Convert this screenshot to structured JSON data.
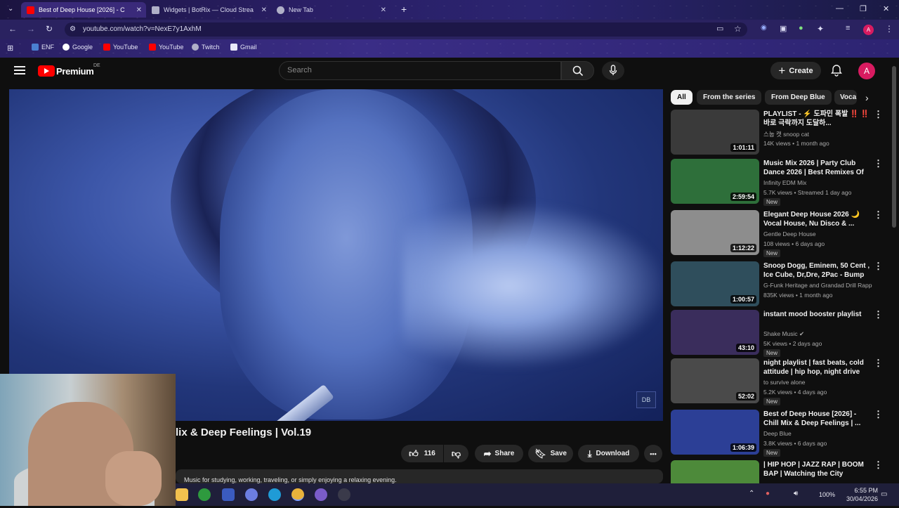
{
  "browser": {
    "tabs": [
      {
        "title": "Best of Deep House [2026] - C",
        "active": true,
        "favicon_color": "#ff0000"
      },
      {
        "title": "Widgets | BotRix — Cloud Strea",
        "active": false,
        "favicon_color": "#b0b0c8"
      },
      {
        "title": "New Tab",
        "active": false,
        "favicon_color": "#b0b0c8"
      }
    ],
    "new_tab_label": "+",
    "url": "youtube.com/watch?v=NexE7y1AxhM",
    "profile_initial": "A",
    "bookmarks": [
      "ENF",
      "Google",
      "YouTube",
      "YouTube",
      "Twitch",
      "Gmail"
    ]
  },
  "youtube": {
    "logo_text": "Premium",
    "country": "DE",
    "search_placeholder": "Search",
    "create_label": "Create",
    "avatar_initial": "A"
  },
  "video": {
    "title": "lix & Deep Feelings | Vol.19",
    "likes": "116",
    "share_label": "Share",
    "save_label": "Save",
    "download_label": "Download",
    "more_label": "•••",
    "description": "Music for studying, working, traveling, or simply enjoying a relaxing evening."
  },
  "sidebar": {
    "chips": [
      "All",
      "From the series",
      "From Deep Blue",
      "Voca"
    ],
    "items": [
      {
        "title": "PLAYLIST - ⚡ 도파민 폭발 ‼️ ‼️ 바로 극락까지 도달하...",
        "channel": "스눕 캣 snoop cat",
        "meta": "14K views • 1 month ago",
        "duration": "1:01:11",
        "badge": "",
        "thumb": "#3a3a3a"
      },
      {
        "title": "Music Mix 2026 | Party Club Dance 2026 | Best Remixes Of ...",
        "channel": "Infinity EDM Mix",
        "meta": "5.7K views • Streamed 1 day ago",
        "duration": "2:59:54",
        "badge": "New",
        "thumb": "#2e6f3a"
      },
      {
        "title": "Elegant Deep House 2026 🌙 Vocal House, Nu Disco & ...",
        "channel": "Gentle Deep House",
        "meta": "108 views • 6 days ago",
        "duration": "1:12:22",
        "badge": "New",
        "thumb": "#8d8d8d"
      },
      {
        "title": "Snoop Dogg, Eminem, 50 Cent , Ice Cube, Dr,Dre, 2Pac - Bump ...",
        "channel": "G-Funk Heritage and Grandad Drill Rappe...",
        "meta": "835K views • 1 month ago",
        "duration": "1:00:57",
        "badge": "",
        "thumb": "#2f4e5c"
      },
      {
        "title": "instant mood booster playlist",
        "channel": "Shake Music ✔",
        "meta": "5K views • 2 days ago",
        "duration": "43:10",
        "badge": "New",
        "thumb": "#3a2d5c"
      },
      {
        "title": "night playlist | fast beats, cold attitude | hip hop, night drive",
        "channel": "to survive alone",
        "meta": "5.2K views • 4 days ago",
        "duration": "52:02",
        "badge": "New",
        "thumb": "#4a4a4a"
      },
      {
        "title": "Best of Deep House [2026] - Chill Mix & Deep Feelings | ...",
        "channel": "Deep Blue",
        "meta": "3.8K views • 6 days ago",
        "duration": "1:06:39",
        "badge": "New",
        "thumb": "#2c3f96"
      },
      {
        "title": "| HIP HOP | JAZZ RAP | BOOM BAP | Watching the City Breath...",
        "channel": "",
        "meta": "",
        "duration": "",
        "badge": "",
        "thumb": "#4d8a3a"
      }
    ]
  },
  "taskbar": {
    "battery": "100%",
    "time": "6:55 PM",
    "date": "30/04/2026"
  }
}
